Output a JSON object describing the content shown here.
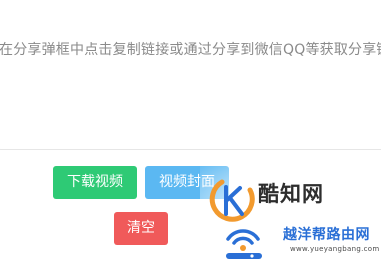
{
  "input": {
    "placeholder": "在分享弹框中点击复制链接或通过分享到微信QQ等获取分享链接"
  },
  "buttons": {
    "download": "下载视频",
    "cover": "视频封面",
    "clear": "清空"
  },
  "colors": {
    "download": "#2eca75",
    "cover": "#5bb8f2",
    "clear": "#f05a5a",
    "watermark_orange": "#f29a2e",
    "watermark_blue": "#2a6fd6"
  },
  "watermark": {
    "site_name_1": "酷知网",
    "site_name_2": "越洋帮路由网",
    "url": "www.yueyangbang.com",
    "logo_icons": [
      "kuzhi-logo-icon",
      "wifi-icon"
    ]
  }
}
